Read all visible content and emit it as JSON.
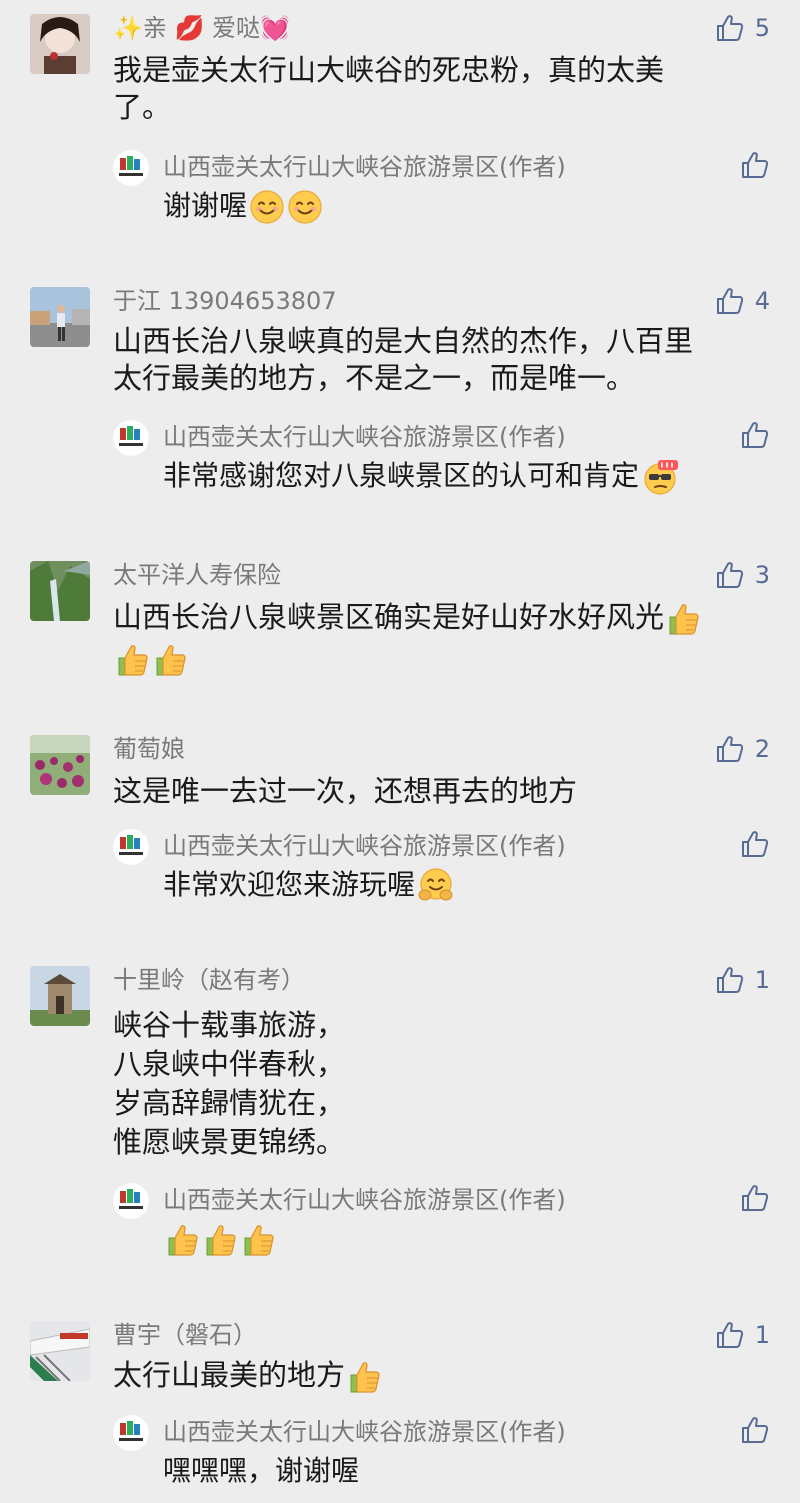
{
  "comments": [
    {
      "name": "✨亲 💋 爱哒💓",
      "likes": "5",
      "text": "我是壶关太行山大峡谷的死忠粉，真的太美\n了。",
      "reply": {
        "author": "山西壶关太行山大峡谷旅游景区(作者)",
        "text": "谢谢喔"
      }
    },
    {
      "name": "于江 13904653807",
      "likes": "4",
      "text": "山西长治八泉峡真的是大自然的杰作，八百里\n太行最美的地方，不是之一，而是唯一。",
      "reply": {
        "author": "山西壶关太行山大峡谷旅游景区(作者)",
        "text": "非常感谢您对八泉峡景区的认可和肯定"
      }
    },
    {
      "name": "太平洋人寿保险",
      "likes": "3",
      "text": "山西长治八泉峡景区确实是好山好水好风光"
    },
    {
      "name": "葡萄娘",
      "likes": "2",
      "text": "这是唯一去过一次，还想再去的地方",
      "reply": {
        "author": "山西壶关太行山大峡谷旅游景区(作者)",
        "text": "非常欢迎您来游玩喔"
      }
    },
    {
      "name": "十里岭（赵有考）",
      "likes": "1",
      "text": "峡谷十载事旅游，\n八泉峡中伴春秋，\n岁高辞歸情犹在，\n惟愿峡景更锦绣。",
      "reply": {
        "author": "山西壶关太行山大峡谷旅游景区(作者)",
        "text": ""
      }
    },
    {
      "name": "曹宇（磐石）",
      "likes": "1",
      "text": "太行山最美的地方",
      "reply": {
        "author": "山西壶关太行山大峡谷旅游景区(作者)",
        "text": "嘿嘿嘿，谢谢喔"
      }
    }
  ],
  "icons": {
    "like": "thumbs-up-outline-icon",
    "emoji_smile": "smiling-face-icon",
    "emoji_cool": "cool-666-face-icon",
    "emoji_hug": "hugging-face-icon",
    "emoji_thumb": "thumbs-up-emoji-icon"
  },
  "colors": {
    "background": "#ededed",
    "name": "#7a7a7a",
    "like": "#576b95",
    "text": "#1a1a1a"
  }
}
